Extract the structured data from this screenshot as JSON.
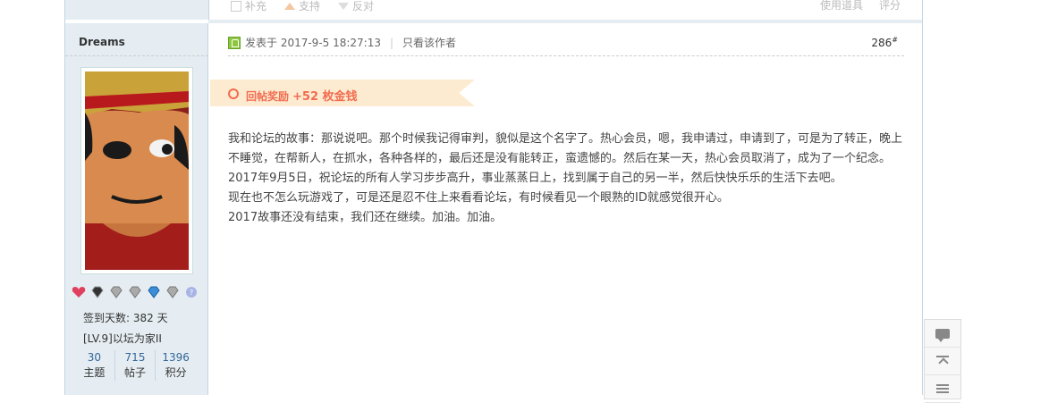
{
  "prev_post": {
    "actions": [
      "补充",
      "支持",
      "反对"
    ],
    "tools_label": "使用道具",
    "rate_label": "评分"
  },
  "author": {
    "name": "Dreams",
    "checkin": "签到天数: 382 天",
    "level": "[LV.9]以坛为家II",
    "stats": [
      {
        "value": "30",
        "label": "主题"
      },
      {
        "value": "715",
        "label": "帖子"
      },
      {
        "value": "1396",
        "label": "积分"
      }
    ],
    "medal_icons": [
      "heart-medal-icon",
      "gem-medal-icon",
      "diamond-medal-icon",
      "diamond-medal-icon",
      "blue-gem-medal-icon",
      "diamond-medal-icon",
      "help-icon"
    ]
  },
  "post": {
    "posted_at": "发表于 2017-9-5 18:27:13",
    "only_author": "只看该作者",
    "floor": "286",
    "floor_mark": "#",
    "reward_label": "回帖奖励",
    "reward_amount": "+52 枚金钱",
    "paragraphs": [
      "我和论坛的故事：那说说吧。那个时候我记得审判，貌似是这个名字了。热心会员，嗯，我申请过，申请到了，可是为了转正，晚上不睡觉，在帮新人，在抓水，各种各样的，最后还是没有能转正，蛮遗憾的。然后在某一天，热心会员取消了，成为了一个纪念。",
      "2017年9月5日，祝论坛的所有人学习步步高升，事业蒸蒸日上，找到属于自己的另一半，然后快快乐乐的生活下去吧。",
      "现在也不怎么玩游戏了，可是还是忍不住上来看看论坛，有时候看见一个眼熟的ID就感觉很开心。",
      "2017故事还没有结束，我们还在继续。加油。加油。"
    ]
  },
  "colors": {
    "sidebar_bg": "#e5edf2",
    "border": "#c2d5e3",
    "reward_bg": "#fdebd1",
    "reward_text": "#f26c4f",
    "stat_number": "#336699"
  },
  "float_tools": [
    "reply-bubble-icon",
    "back-to-top-icon",
    "list-icon"
  ]
}
